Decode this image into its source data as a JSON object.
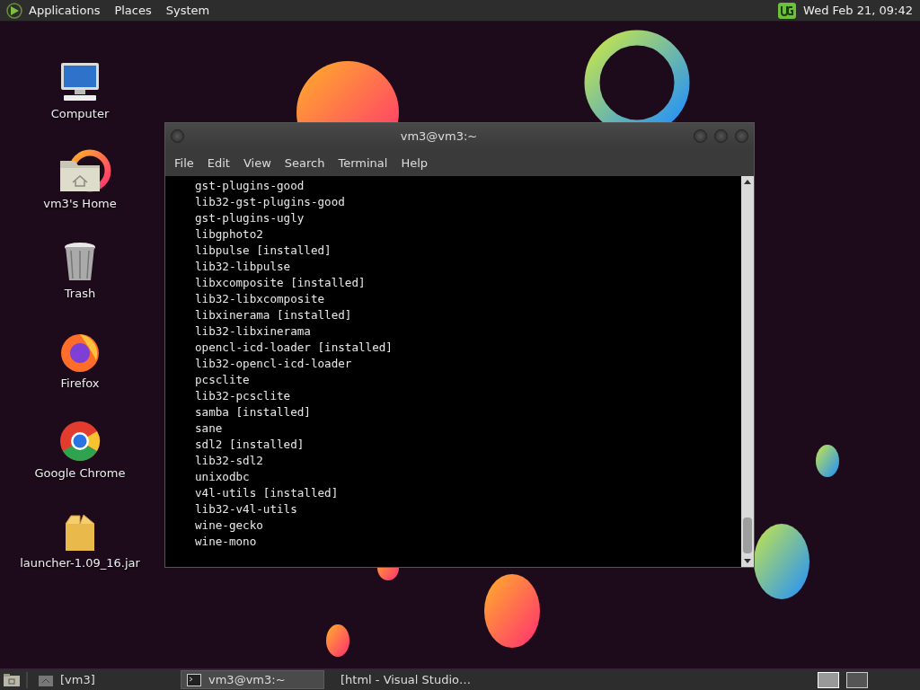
{
  "top_panel": {
    "menus": [
      "Applications",
      "Places",
      "System"
    ],
    "clock": "Wed Feb 21, 09:42"
  },
  "desktop_icons": [
    {
      "kind": "computer",
      "label": "Computer"
    },
    {
      "kind": "home",
      "label": "vm3's Home"
    },
    {
      "kind": "trash",
      "label": "Trash"
    },
    {
      "kind": "firefox",
      "label": "Firefox"
    },
    {
      "kind": "chrome",
      "label": "Google Chrome"
    },
    {
      "kind": "package",
      "label": "launcher-1.09_16.jar"
    }
  ],
  "terminal": {
    "title": "vm3@vm3:~",
    "menus": [
      "File",
      "Edit",
      "View",
      "Search",
      "Terminal",
      "Help"
    ],
    "lines": [
      "gst-plugins-good",
      "lib32-gst-plugins-good",
      "gst-plugins-ugly",
      "libgphoto2",
      "libpulse [installed]",
      "lib32-libpulse",
      "libxcomposite [installed]",
      "lib32-libxcomposite",
      "libxinerama [installed]",
      "lib32-libxinerama",
      "opencl-icd-loader [installed]",
      "lib32-opencl-icd-loader",
      "pcsclite",
      "lib32-pcsclite",
      "samba [installed]",
      "sane",
      "sdl2 [installed]",
      "lib32-sdl2",
      "unixodbc",
      "v4l-utils [installed]",
      "lib32-v4l-utils",
      "wine-gecko",
      "wine-mono"
    ]
  },
  "taskbar": {
    "items": [
      {
        "kind": "folder",
        "label": "[vm3]",
        "selected": false
      },
      {
        "kind": "terminal",
        "label": "vm3@vm3:~",
        "selected": true
      },
      {
        "kind": "code",
        "label": "[html - Visual Studio…",
        "selected": false
      }
    ],
    "workspaces": [
      {
        "selected": true
      },
      {
        "selected": false
      }
    ]
  }
}
